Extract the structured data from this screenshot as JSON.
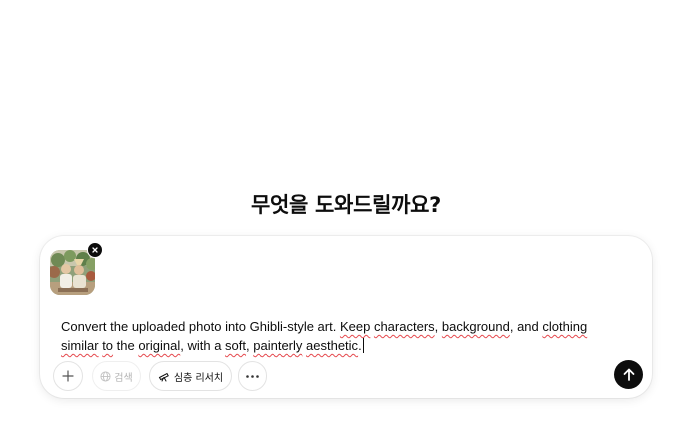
{
  "heading": "무엇을 도와드릴까요?",
  "composer": {
    "prompt_segments": [
      {
        "text": "Convert the uploaded photo into Ghibli-style art. ",
        "spell": false
      },
      {
        "text": "Keep",
        "spell": true
      },
      {
        "text": " ",
        "spell": false
      },
      {
        "text": "characters",
        "spell": true
      },
      {
        "text": ", ",
        "spell": false
      },
      {
        "text": "background",
        "spell": true
      },
      {
        "text": ", and ",
        "spell": false
      },
      {
        "text": "clothing",
        "spell": true
      },
      {
        "text": " ",
        "spell": false
      },
      {
        "text": "similar",
        "spell": true
      },
      {
        "text": " ",
        "spell": false
      },
      {
        "text": "to",
        "spell": true
      },
      {
        "text": " the ",
        "spell": false
      },
      {
        "text": "original",
        "spell": true
      },
      {
        "text": ", with a ",
        "spell": false
      },
      {
        "text": "soft",
        "spell": true
      },
      {
        "text": ", ",
        "spell": false
      },
      {
        "text": "painterly",
        "spell": true
      },
      {
        "text": " ",
        "spell": false
      },
      {
        "text": "aesthetic",
        "spell": true
      },
      {
        "text": ".",
        "spell": false
      }
    ],
    "attachment": {
      "icon": "image-thumbnail",
      "remove_icon": "close-icon"
    },
    "toolbar": {
      "add_icon": "plus-icon",
      "search_label": "검색",
      "search_icon": "globe-icon",
      "search_disabled": true,
      "deep_research_label": "심층 리서치",
      "deep_research_icon": "telescope-icon",
      "more_icon": "ellipsis-icon"
    },
    "send_icon": "arrow-up-icon"
  },
  "colors": {
    "text": "#0d0d0d",
    "muted": "#b4b4b4",
    "border": "#e3e3e3",
    "spellcheck": "#e5484d",
    "send_bg": "#0d0d0d"
  }
}
